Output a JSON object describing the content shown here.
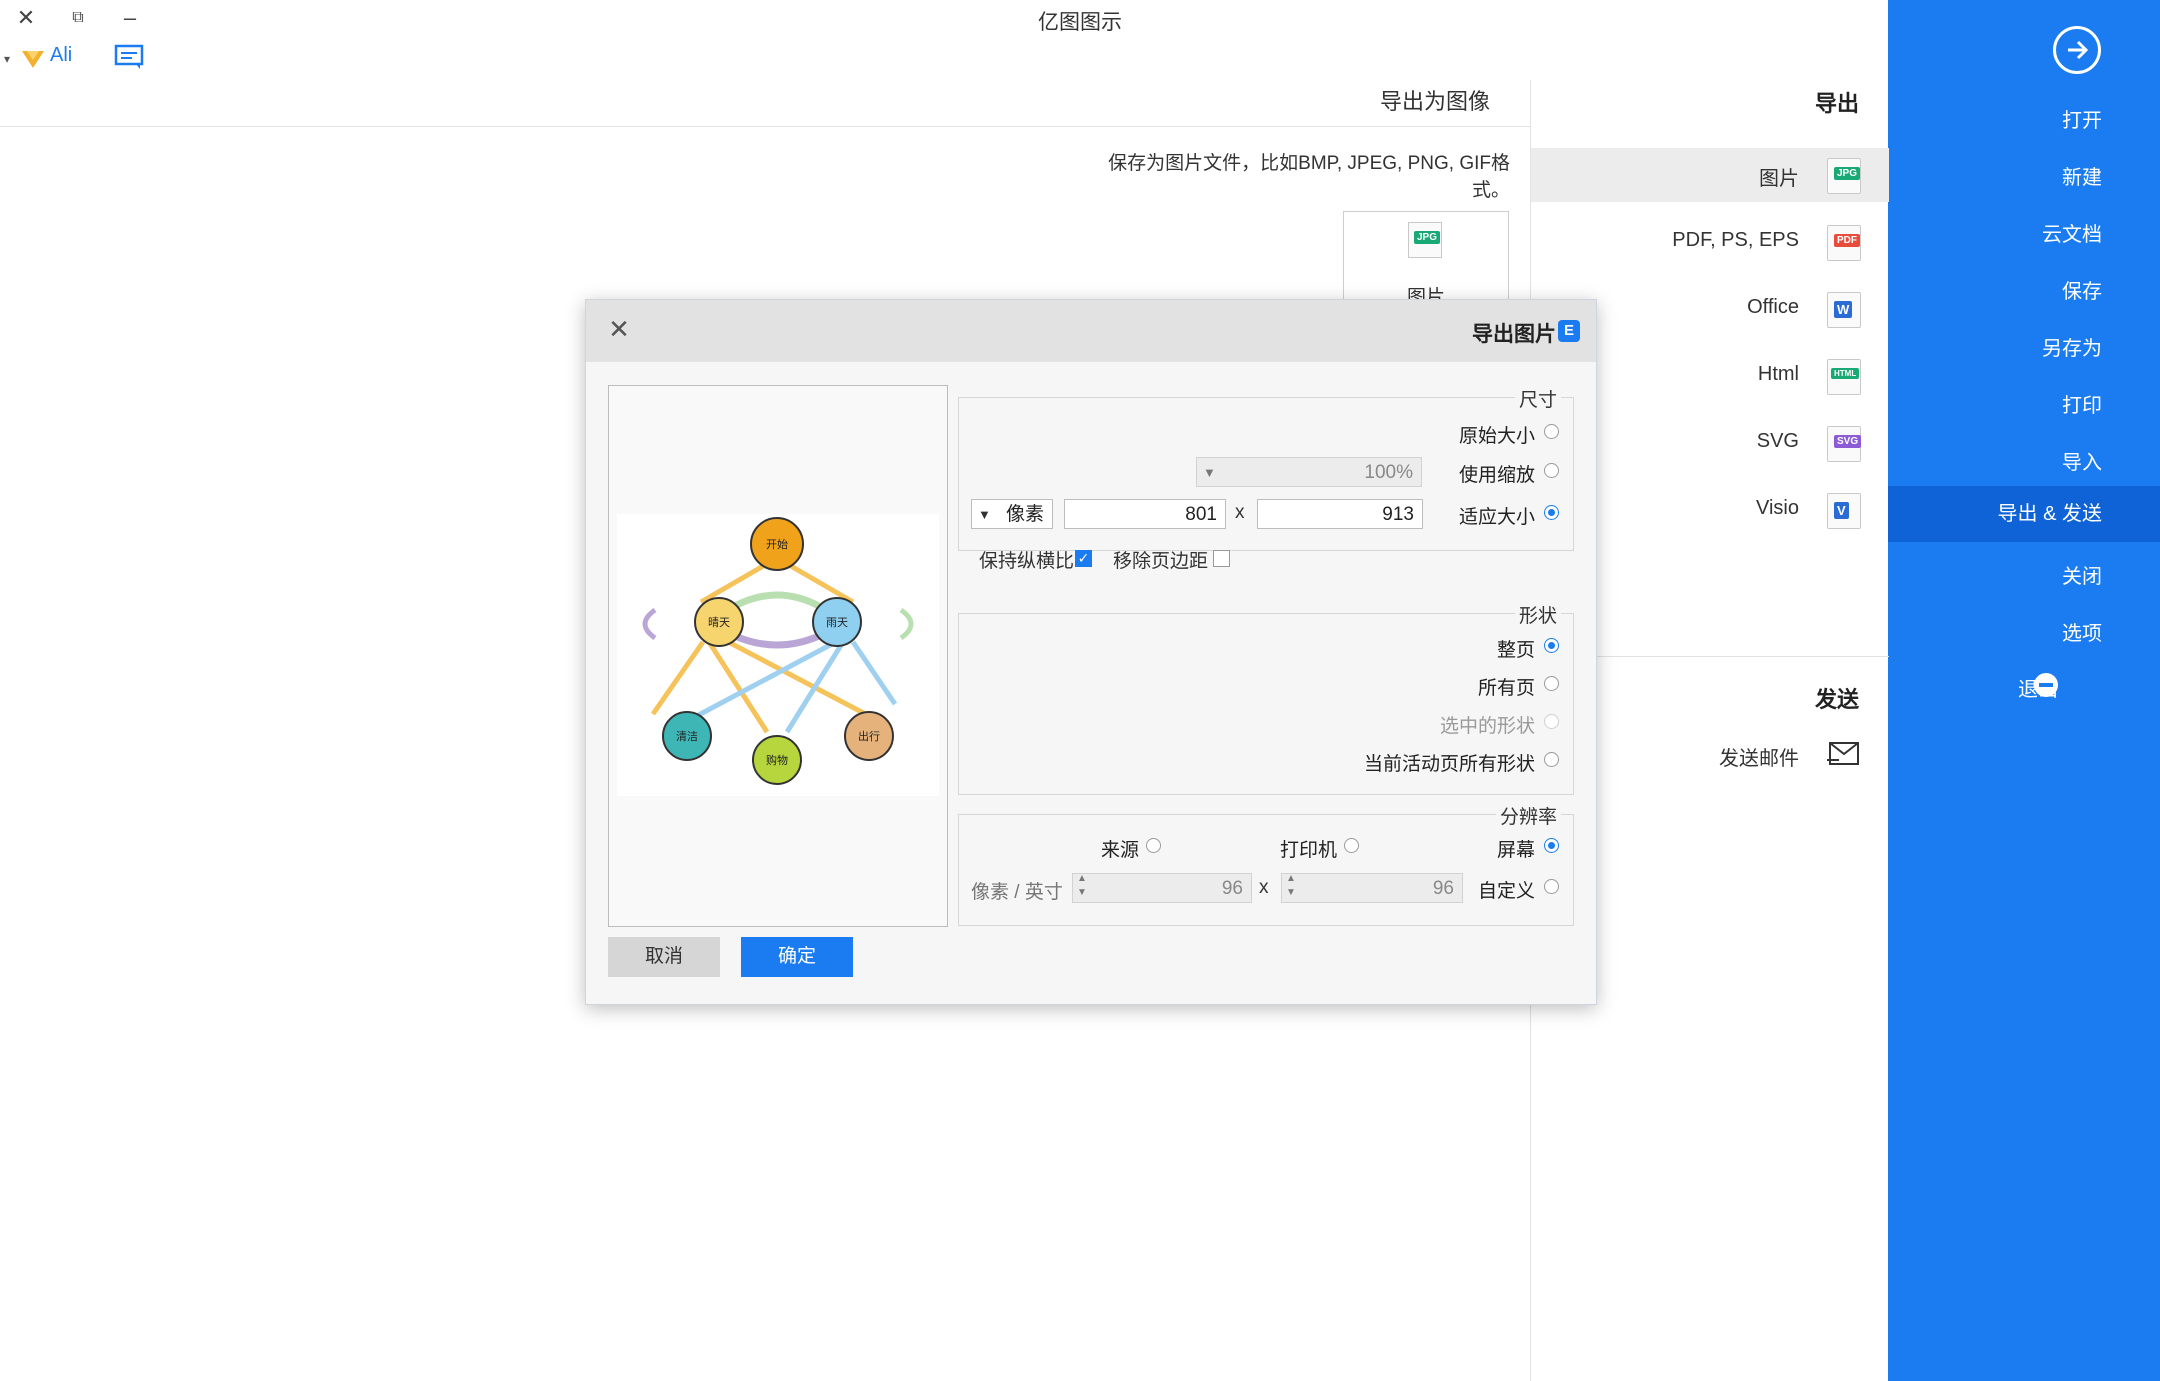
{
  "window": {
    "title": "亿图图示",
    "minimize_glyph": "–",
    "restore_glyph": "⧉",
    "close_glyph": "✕"
  },
  "toolbar": {
    "user_label": "Ali"
  },
  "sidebar": {
    "items": [
      {
        "label": "打开"
      },
      {
        "label": "新建"
      },
      {
        "label": "云文档"
      },
      {
        "label": "保存"
      },
      {
        "label": "另存为"
      },
      {
        "label": "打印"
      },
      {
        "label": "导入"
      },
      {
        "label": "导出 & 发送"
      },
      {
        "label": "关闭"
      },
      {
        "label": "选项"
      },
      {
        "label": "退出"
      }
    ],
    "accent": "#1a7cf0"
  },
  "middle": {
    "export_heading": "导出",
    "export_items": [
      {
        "label": "图片",
        "badge": "JPG",
        "badge_color": "#19a974"
      },
      {
        "label": "PDF, PS, EPS",
        "badge": "PDF",
        "badge_color": "#e74c3c"
      },
      {
        "label": "Office",
        "badge": "W",
        "badge_color": "#2b6cd4"
      },
      {
        "label": "Html",
        "badge": "HTML",
        "badge_color": "#19a974"
      },
      {
        "label": "SVG",
        "badge": "SVG",
        "badge_color": "#8e5bd6"
      },
      {
        "label": "Visio",
        "badge": "V",
        "badge_color": "#2b6cd4"
      }
    ],
    "send_heading": "发送",
    "send_items": [
      {
        "label": "发送邮件"
      }
    ]
  },
  "content": {
    "title": "导出为图像",
    "description": "保存为图片文件，比如BMP, JPEG, PNG, GIF格式。",
    "card_label": "图片",
    "card_badge": "JPG"
  },
  "dialog": {
    "title": "导出图片",
    "title_icon": "E",
    "close_glyph": "✕",
    "size": {
      "legend": "尺寸",
      "original_label": "原始大小",
      "zoom_label": "使用缩放",
      "zoom_value": "100%",
      "fit_label": "适应大小",
      "width_value": "913",
      "x_label": "x",
      "height_value": "801",
      "unit_value": "像素",
      "remove_margin_label": "移除页边距",
      "keep_ratio_label": "保持纵横比"
    },
    "shape": {
      "legend": "形状",
      "options": [
        "整页",
        "所有页",
        "选中的形状",
        "当前活动页所有形状"
      ]
    },
    "resolution": {
      "legend": "分辨率",
      "screen_label": "屏幕",
      "printer_label": "打印机",
      "source_label": "来源",
      "custom_label": "自定义",
      "dpi_x": "96",
      "x_label": "x",
      "dpi_y": "96",
      "unit_label": "像素 / 英寸"
    },
    "ok_label": "确定",
    "cancel_label": "取消"
  },
  "preview_diagram": {
    "nodes": [
      "开始",
      "雨天",
      "晴天",
      "出行",
      "购物",
      "清洁"
    ],
    "node_colors": [
      "#f0a21a",
      "#8fd0f0",
      "#f7d56e",
      "#e6b27c",
      "#b7d63d",
      "#3fb6b6"
    ]
  }
}
